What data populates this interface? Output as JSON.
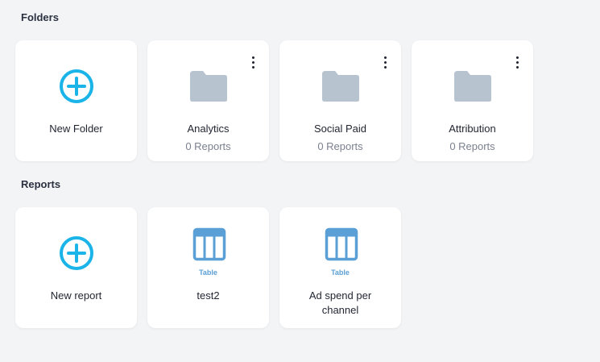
{
  "folders_section": {
    "title": "Folders"
  },
  "new_folder": {
    "label": "New Folder"
  },
  "folders": [
    {
      "name": "Analytics",
      "count": "0 Reports"
    },
    {
      "name": "Social Paid",
      "count": "0 Reports"
    },
    {
      "name": "Attribution",
      "count": "0 Reports"
    }
  ],
  "reports_section": {
    "title": "Reports"
  },
  "new_report": {
    "label": "New report"
  },
  "reports": [
    {
      "type": "Table",
      "name": "test2"
    },
    {
      "type": "Table",
      "name": "Ad spend per channel"
    }
  ],
  "colors": {
    "plus_accent": "#1ab4e8",
    "folder_gray": "#b8c3d0",
    "table_blue": "#5a9fd6"
  }
}
